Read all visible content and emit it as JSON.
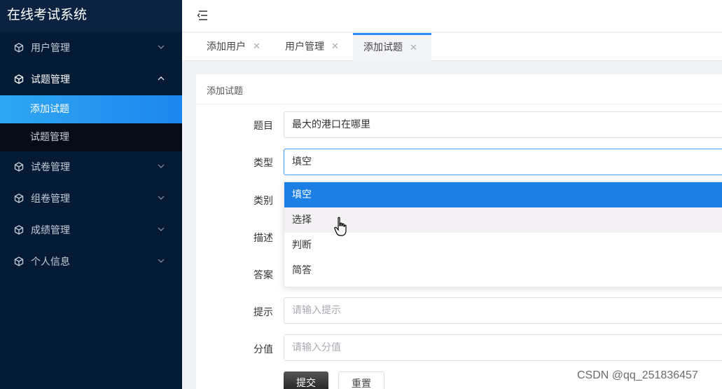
{
  "app": {
    "title": "在线考试系统"
  },
  "sidebar": {
    "items": [
      {
        "label": "用户管理",
        "icon": "cube-icon",
        "expanded": false
      },
      {
        "label": "试题管理",
        "icon": "cube-icon",
        "expanded": true,
        "children": [
          {
            "label": "添加试题",
            "active": true
          },
          {
            "label": "试题管理",
            "active": false
          }
        ]
      },
      {
        "label": "试卷管理",
        "icon": "cube-icon",
        "expanded": false
      },
      {
        "label": "组卷管理",
        "icon": "cube-icon",
        "expanded": false
      },
      {
        "label": "成绩管理",
        "icon": "cube-icon",
        "expanded": false
      },
      {
        "label": "个人信息",
        "icon": "cube-icon",
        "expanded": false
      }
    ]
  },
  "tabs": [
    {
      "label": "添加用户",
      "active": false
    },
    {
      "label": "用户管理",
      "active": false
    },
    {
      "label": "添加试题",
      "active": true
    }
  ],
  "card": {
    "title": "添加试题"
  },
  "form": {
    "title_label": "题目",
    "title_value": "最大的港口在哪里",
    "type_label": "类型",
    "type_value": "填空",
    "category_label": "类别",
    "desc_label": "描述",
    "answer_label": "答案",
    "hint_label": "提示",
    "hint_placeholder": "请输入提示",
    "score_label": "分值",
    "score_placeholder": "请输入分值",
    "submit_label": "提交",
    "reset_label": "重置"
  },
  "type_options": [
    {
      "label": "填空",
      "state": "selected"
    },
    {
      "label": "选择",
      "state": "hover"
    },
    {
      "label": "判断",
      "state": "normal"
    },
    {
      "label": "简答",
      "state": "normal"
    }
  ],
  "watermark": "CSDN @qq_251836457",
  "colors": {
    "sidebar_bg": "#051b35",
    "active_item": "#1b86ee",
    "accent": "#2d8cf0",
    "option_selected": "#1b7fe6"
  }
}
